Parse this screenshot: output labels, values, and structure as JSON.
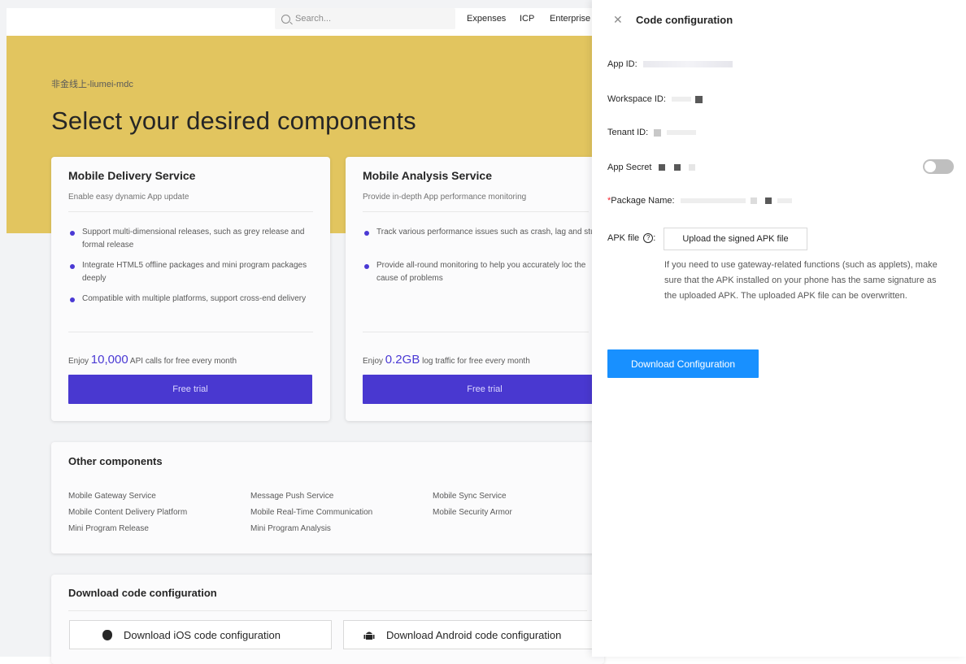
{
  "header": {
    "search_placeholder": "Search...",
    "nav": [
      "Expenses",
      "ICP",
      "Enterprise"
    ]
  },
  "hero": {
    "org": "非金线上-liumei-mdc",
    "title": "Select your desired components"
  },
  "cards": [
    {
      "title": "Mobile Delivery Service",
      "subtitle": "Enable easy dynamic App update",
      "features": [
        "Support multi-dimensional releases, such as grey release and formal release",
        "Integrate HTML5 offline packages and mini program packages deeply",
        "Compatible with multiple platforms, support cross-end delivery"
      ],
      "enjoy_prefix": "Enjoy",
      "enjoy_value": "10,000",
      "enjoy_suffix": "API calls for free every month",
      "button": "Free trial"
    },
    {
      "title": "Mobile Analysis Service",
      "subtitle": "Provide in-depth App performance monitoring",
      "features": [
        "Track various performance issues such as crash, lag and stuck",
        "Provide all-round monitoring to help you accurately loc the cause of problems"
      ],
      "enjoy_prefix": "Enjoy",
      "enjoy_value": "0.2GB",
      "enjoy_suffix": "log traffic for free every month",
      "button": "Free trial"
    }
  ],
  "other_components": {
    "title": "Other components",
    "items": [
      "Mobile Gateway Service",
      "Message Push Service",
      "Mobile Sync Service",
      "Mobile Content Delivery Platform",
      "Mobile Real-Time Communication",
      "Mobile Security Armor",
      "Mini Program Release",
      "Mini Program Analysis"
    ]
  },
  "download_section": {
    "title": "Download code configuration",
    "ios_button": "Download iOS code configuration",
    "android_button": "Download Android code configuration"
  },
  "drawer": {
    "title": "Code configuration",
    "app_id_label": "App ID:",
    "workspace_id_label": "Workspace ID:",
    "tenant_id_label": "Tenant ID:",
    "app_secret_label": "App Secret",
    "app_secret_toggle_on": false,
    "package_name_required": "*",
    "package_name_label": "Package Name:",
    "apk_label": "APK file",
    "apk_colon": ":",
    "upload_button": "Upload the signed APK file",
    "note": "If you need to use gateway-related functions (such as applets), make sure that the APK installed on your phone has the same signature as the uploaded APK. The uploaded APK file can be overwritten.",
    "download_button": "Download Configuration"
  },
  "colors": {
    "hero_bg": "#e2c55f",
    "trial_button": "#4938d0",
    "primary": "#1890ff"
  }
}
